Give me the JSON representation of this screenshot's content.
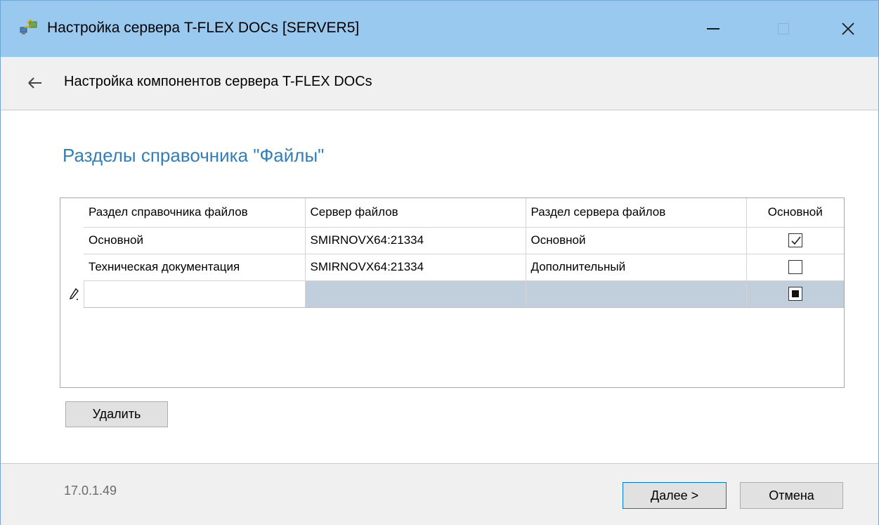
{
  "window": {
    "title": "Настройка сервера T-FLEX DOCs [SERVER5]"
  },
  "nav": {
    "title": "Настройка компонентов сервера T-FLEX DOCs"
  },
  "section": {
    "title": "Разделы справочника \"Файлы\""
  },
  "grid": {
    "columns": [
      "Раздел справочника файлов",
      "Сервер файлов",
      "Раздел сервера файлов",
      "Основной"
    ],
    "rows": [
      {
        "section": "Основной",
        "server": "SMIRNOVX64:21334",
        "server_section": "Основной",
        "primary": "checked"
      },
      {
        "section": "Техническая документация",
        "server": "SMIRNOVX64:21334",
        "server_section": "Дополнительный",
        "primary": "unchecked"
      },
      {
        "section": "",
        "server": "",
        "server_section": "",
        "primary": "indeterminate"
      }
    ]
  },
  "buttons": {
    "delete": "Удалить",
    "next": "Далее >",
    "cancel": "Отмена"
  },
  "footer": {
    "version": "17.0.1.49"
  },
  "colors": {
    "titlebar": "#99c9ef",
    "accent_title": "#2f7fbd",
    "new_row_shade": "#c0cfdb",
    "focus_border": "#0078d7"
  }
}
